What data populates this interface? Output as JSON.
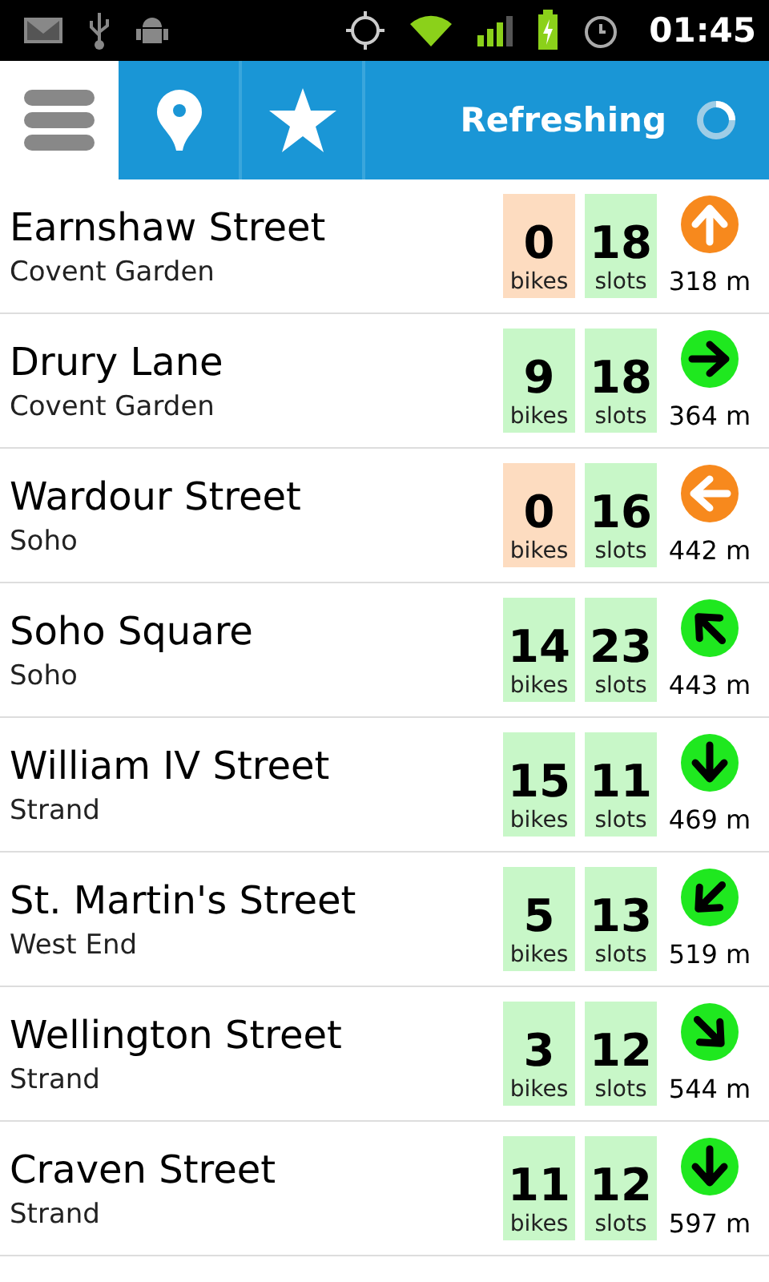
{
  "status_bar": {
    "time": "01:45"
  },
  "action_bar": {
    "title": "Refreshing"
  },
  "stations": [
    {
      "name": "Earnshaw Street",
      "area": "Covent Garden",
      "bikes": {
        "count": "0",
        "label": "bikes",
        "empty": true
      },
      "slots": {
        "count": "18",
        "label": "slots",
        "empty": false
      },
      "kind": "north",
      "color": "#f7891d",
      "distance": "318 m"
    },
    {
      "name": "Drury Lane",
      "area": "Covent Garden",
      "bikes": {
        "count": "9",
        "label": "bikes",
        "empty": false
      },
      "slots": {
        "count": "18",
        "label": "slots",
        "empty": false
      },
      "kind": "east",
      "color": "#1fe81f",
      "distance": "364 m"
    },
    {
      "name": "Wardour Street",
      "area": "Soho",
      "bikes": {
        "count": "0",
        "label": "bikes",
        "empty": true
      },
      "slots": {
        "count": "16",
        "label": "slots",
        "empty": false
      },
      "kind": "west",
      "color": "#f7891d",
      "distance": "442 m"
    },
    {
      "name": "Soho Square",
      "area": "Soho",
      "bikes": {
        "count": "14",
        "label": "bikes",
        "empty": false
      },
      "slots": {
        "count": "23",
        "label": "slots",
        "empty": false
      },
      "kind": "northwest",
      "color": "#1fe81f",
      "distance": "443 m"
    },
    {
      "name": "William IV Street",
      "area": "Strand",
      "bikes": {
        "count": "15",
        "label": "bikes",
        "empty": false
      },
      "slots": {
        "count": "11",
        "label": "slots",
        "empty": false
      },
      "kind": "south",
      "color": "#1fe81f",
      "distance": "469 m"
    },
    {
      "name": "St. Martin's Street",
      "area": "West End",
      "bikes": {
        "count": "5",
        "label": "bikes",
        "empty": false
      },
      "slots": {
        "count": "13",
        "label": "slots",
        "empty": false
      },
      "kind": "southwest",
      "color": "#1fe81f",
      "distance": "519 m"
    },
    {
      "name": "Wellington Street",
      "area": "Strand",
      "bikes": {
        "count": "3",
        "label": "bikes",
        "empty": false
      },
      "slots": {
        "count": "12",
        "label": "slots",
        "empty": false
      },
      "kind": "southeast",
      "color": "#1fe81f",
      "distance": "544 m"
    },
    {
      "name": "Craven Street",
      "area": "Strand",
      "bikes": {
        "count": "11",
        "label": "bikes",
        "empty": false
      },
      "slots": {
        "count": "12",
        "label": "slots",
        "empty": false
      },
      "kind": "south",
      "color": "#1fe81f",
      "distance": "597 m"
    }
  ]
}
